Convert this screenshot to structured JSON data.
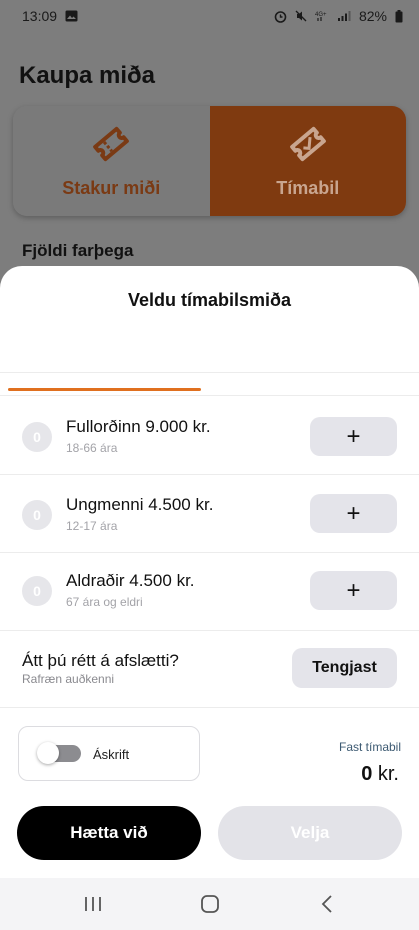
{
  "status_bar": {
    "time": "13:09",
    "battery": "82%",
    "icons": [
      "gallery-icon",
      "alarm-icon",
      "mute-icon",
      "network-4g-icon",
      "signal-icon",
      "battery-icon"
    ]
  },
  "background_page": {
    "title": "Kaupa miða",
    "segment_single_label": "Stakur miði",
    "segment_single_icon": "ticket-icon",
    "segment_period_label": "Tímabil",
    "segment_period_icon": "period-ticket-icon",
    "passenger_heading": "Fjöldi farþega"
  },
  "sheet": {
    "title": "Veldu tímabilsmiða",
    "accent_color": "#e0701f",
    "passengers": [
      {
        "count": "0",
        "title": "Fullorðinn 9.000 kr.",
        "subtitle": "18-66 ára",
        "add_label": "+"
      },
      {
        "count": "0",
        "title": "Ungmenni 4.500 kr.",
        "subtitle": "12-17 ára",
        "add_label": "+"
      },
      {
        "count": "0",
        "title": "Aldraðir 4.500 kr.",
        "subtitle": "67 ára og eldri",
        "add_label": "+"
      }
    ],
    "discount": {
      "question": "Átt þú rétt á afslætti?",
      "subtitle": "Rafræn auðkenni",
      "button_label": "Tengjast"
    },
    "subscription": {
      "label": "Áskrift",
      "enabled": false
    },
    "summary": {
      "label": "Fast tímabil",
      "amount": "0",
      "currency": "kr."
    },
    "cancel_label": "Hætta við",
    "choose_label": "Velja"
  },
  "nav_bar": {
    "items": [
      "recent-apps-icon",
      "home-icon",
      "back-icon"
    ]
  }
}
